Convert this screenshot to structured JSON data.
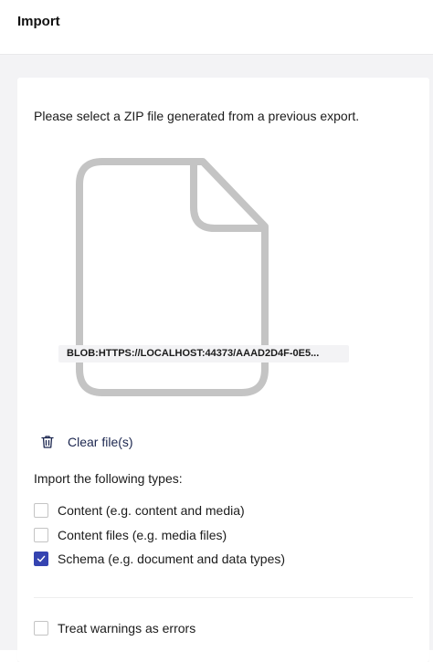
{
  "header": {
    "title": "Import"
  },
  "main": {
    "instructions": "Please select a ZIP file generated from a previous export.",
    "file": {
      "icon": "file-icon",
      "name": "BLOB:HTTPS://LOCALHOST:44373/AAAD2D4F-0E5..."
    },
    "clear_button": {
      "icon": "trash-icon",
      "label": "Clear file(s)"
    },
    "types_label": "Import the following types:",
    "options": [
      {
        "label": "Content (e.g. content and media)",
        "checked": false
      },
      {
        "label": "Content files (e.g. media files)",
        "checked": false
      },
      {
        "label": "Schema (e.g. document and data types)",
        "checked": true
      }
    ],
    "warnings_option": {
      "label": "Treat warnings as errors",
      "checked": false
    }
  },
  "colors": {
    "accent": "#3544b1",
    "background": "#f3f3f5",
    "icon_gray": "#c4c4c4"
  }
}
